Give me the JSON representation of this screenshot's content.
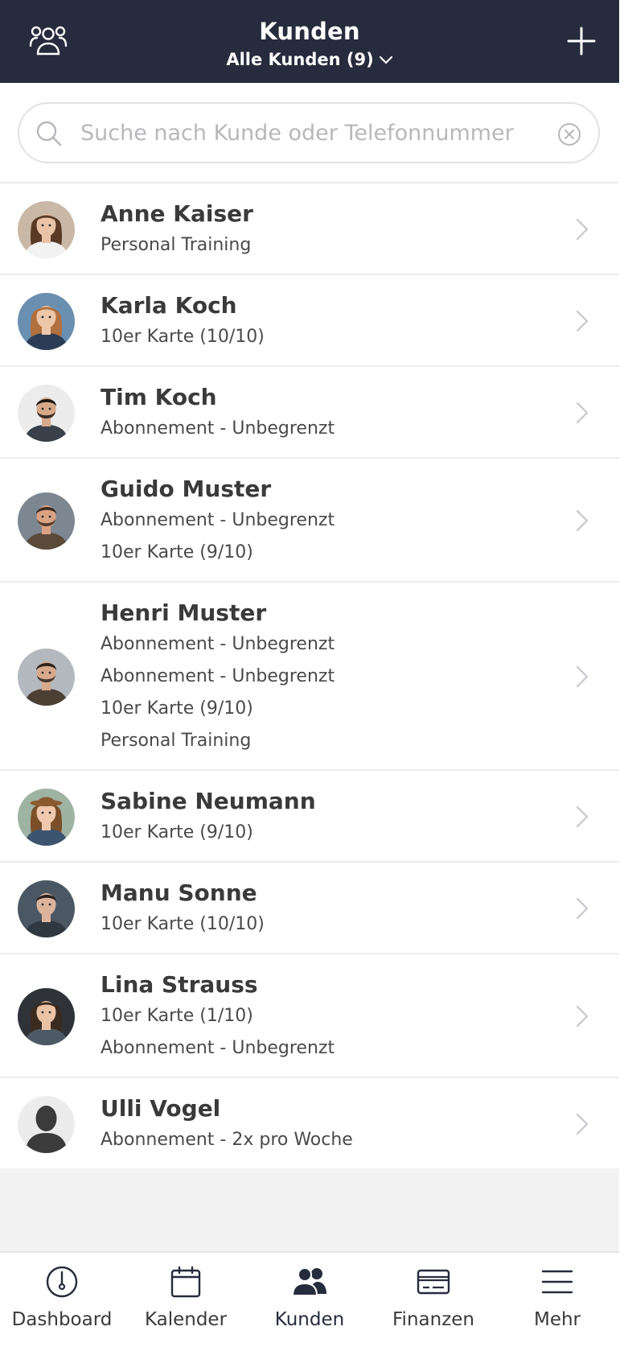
{
  "header": {
    "title": "Kunden",
    "filter_label": "Alle Kunden (9)",
    "left_icon": "group-icon",
    "right_icon": "plus-icon"
  },
  "search": {
    "placeholder": "Suche nach Kunde oder Telefonnummer",
    "value": ""
  },
  "customers": [
    {
      "name": "Anne Kaiser",
      "lines": [
        "Personal Training"
      ]
    },
    {
      "name": "Karla Koch",
      "lines": [
        "10er Karte (10/10)"
      ]
    },
    {
      "name": "Tim Koch",
      "lines": [
        "Abonnement - Unbegrenzt"
      ]
    },
    {
      "name": "Guido Muster",
      "lines": [
        "Abonnement - Unbegrenzt",
        "10er Karte (9/10)"
      ]
    },
    {
      "name": "Henri Muster",
      "lines": [
        "Abonnement - Unbegrenzt",
        "Abonnement - Unbegrenzt",
        "10er Karte (9/10)",
        "Personal Training"
      ]
    },
    {
      "name": "Sabine Neumann",
      "lines": [
        "10er Karte (9/10)"
      ]
    },
    {
      "name": "Manu Sonne",
      "lines": [
        "10er Karte (10/10)"
      ]
    },
    {
      "name": "Lina Strauss",
      "lines": [
        "10er Karte (1/10)",
        "Abonnement - Unbegrenzt"
      ]
    },
    {
      "name": "Ulli Vogel",
      "lines": [
        "Abonnement - 2x pro Woche"
      ]
    }
  ],
  "tabs": [
    {
      "label": "Dashboard",
      "icon": "dashboard-gauge-icon"
    },
    {
      "label": "Kalender",
      "icon": "calendar-icon"
    },
    {
      "label": "Kunden",
      "icon": "customers-icon",
      "active": true
    },
    {
      "label": "Finanzen",
      "icon": "credit-card-icon"
    },
    {
      "label": "Mehr",
      "icon": "menu-icon"
    }
  ],
  "colors": {
    "header_bg": "#262b3d",
    "text_primary": "#3a3a3a",
    "placeholder": "#b8b8bc",
    "chevron": "#c7c7cc"
  }
}
